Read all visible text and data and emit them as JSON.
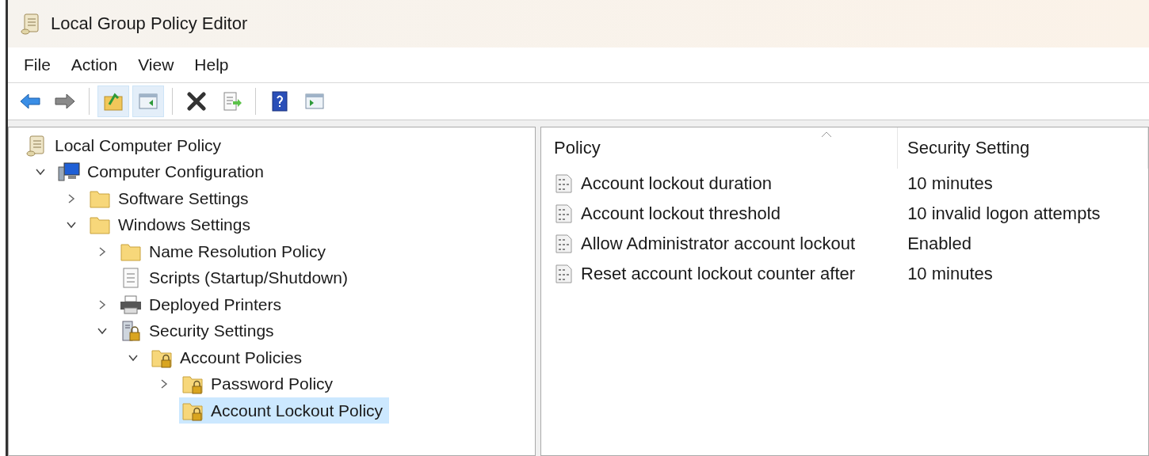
{
  "window": {
    "title": "Local Group Policy Editor"
  },
  "menu": [
    "File",
    "Action",
    "View",
    "Help"
  ],
  "toolbar": [
    {
      "kind": "back",
      "selected": false
    },
    {
      "kind": "forward",
      "selected": false
    },
    {
      "kind": "sep"
    },
    {
      "kind": "up",
      "selected": true
    },
    {
      "kind": "tree",
      "selected": true
    },
    {
      "kind": "sep"
    },
    {
      "kind": "delete",
      "selected": false
    },
    {
      "kind": "export",
      "selected": false
    },
    {
      "kind": "sep"
    },
    {
      "kind": "help",
      "selected": false
    },
    {
      "kind": "pane",
      "selected": false
    }
  ],
  "tree": [
    {
      "label": "Local Computer Policy",
      "kind": "scroll",
      "selected": false,
      "children": [
        {
          "label": "Computer Configuration",
          "kind": "computer",
          "expanded": true,
          "selected": false,
          "children": [
            {
              "label": "Software Settings",
              "kind": "folder",
              "expanded": false,
              "selected": false
            },
            {
              "label": "Windows Settings",
              "kind": "folder",
              "expanded": true,
              "selected": false,
              "children": [
                {
                  "label": "Name Resolution Policy",
                  "kind": "folder",
                  "expanded": false,
                  "selected": false
                },
                {
                  "label": "Scripts (Startup/Shutdown)",
                  "kind": "script",
                  "selected": false
                },
                {
                  "label": "Deployed Printers",
                  "kind": "printer",
                  "expanded": false,
                  "selected": false
                },
                {
                  "label": "Security Settings",
                  "kind": "security",
                  "expanded": true,
                  "selected": false,
                  "children": [
                    {
                      "label": "Account Policies",
                      "kind": "lockfolder",
                      "expanded": true,
                      "selected": false,
                      "children": [
                        {
                          "label": "Password Policy",
                          "kind": "lockfolder",
                          "expanded": false,
                          "selected": false
                        },
                        {
                          "label": "Account Lockout Policy",
                          "kind": "lockfolder",
                          "selected": true
                        }
                      ]
                    }
                  ]
                }
              ]
            }
          ]
        }
      ]
    }
  ],
  "table": {
    "columns": [
      "Policy",
      "Security Setting"
    ],
    "rows": [
      [
        "Account lockout duration",
        "10 minutes"
      ],
      [
        "Account lockout threshold",
        "10 invalid logon attempts"
      ],
      [
        "Allow Administrator account lockout",
        "Enabled"
      ],
      [
        "Reset account lockout counter after",
        "10 minutes"
      ]
    ]
  }
}
